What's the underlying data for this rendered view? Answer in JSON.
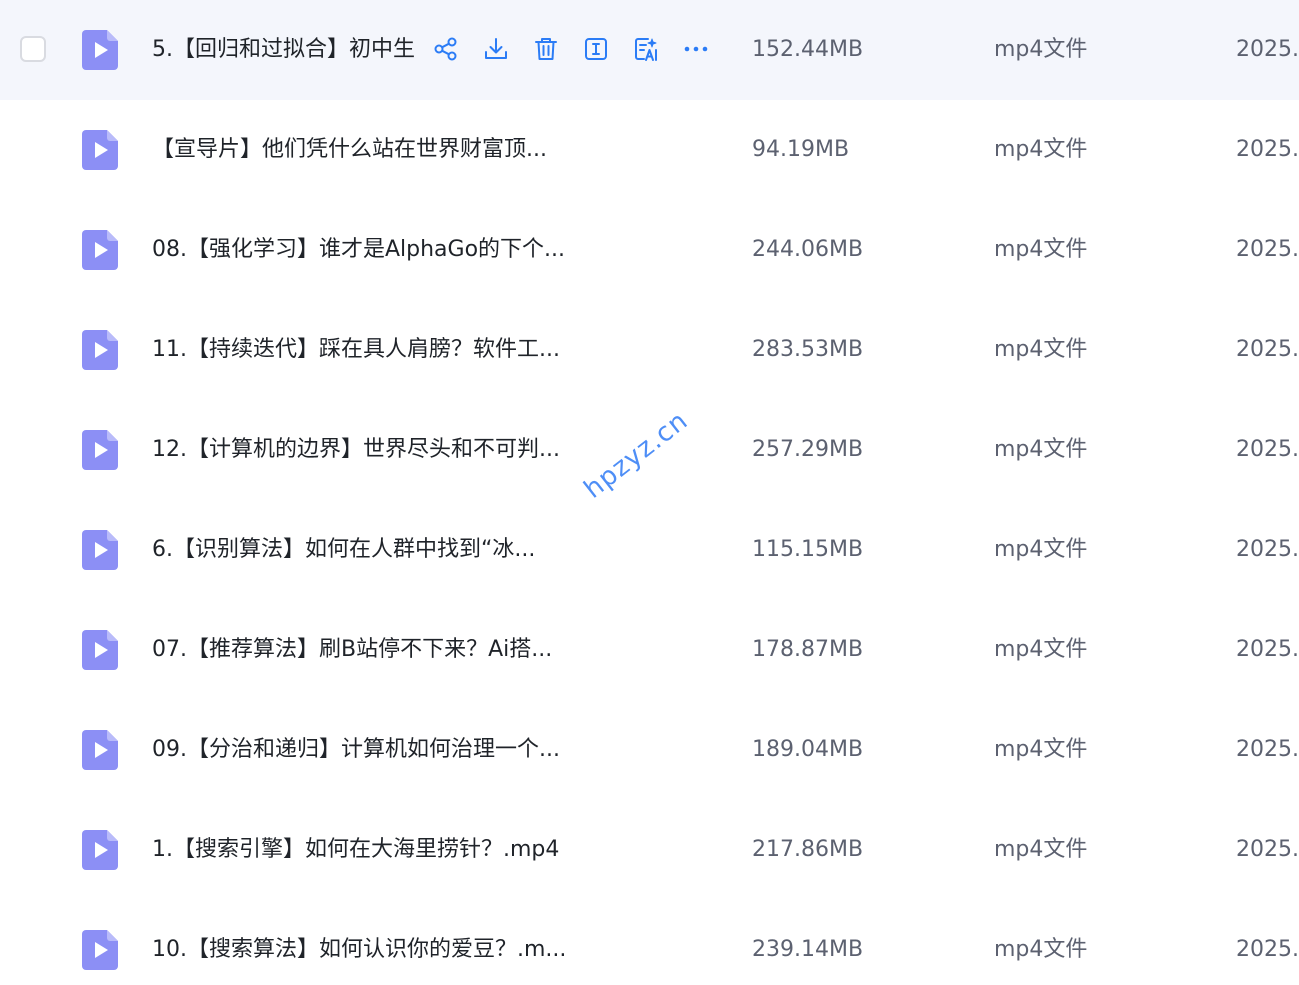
{
  "colors": {
    "accent": "#2b7cf6",
    "row_hover": "#f4f6fc",
    "video_icon": "#8c8ff5",
    "text_primary": "#1f2329",
    "text_secondary": "#5c6170",
    "watermark": "#3b82f6"
  },
  "watermark": "hpzyz.cn",
  "files": [
    {
      "name": "5.【回归和过拟合】初中生",
      "size": "152.44MB",
      "type": "mp4文件",
      "date": "2025.",
      "icon": "video-file-icon"
    },
    {
      "name": "【宣导片】他们凭什么站在世界财富顶...",
      "size": "94.19MB",
      "type": "mp4文件",
      "date": "2025.",
      "icon": "video-file-icon"
    },
    {
      "name": "08.【强化学习】谁才是AlphaGo的下个...",
      "size": "244.06MB",
      "type": "mp4文件",
      "date": "2025.",
      "icon": "video-file-icon"
    },
    {
      "name": "11.【持续迭代】踩在具人肩膀？软件工...",
      "size": "283.53MB",
      "type": "mp4文件",
      "date": "2025.",
      "icon": "video-file-icon"
    },
    {
      "name": "12.【计算机的边界】世界尽头和不可判...",
      "size": "257.29MB",
      "type": "mp4文件",
      "date": "2025.",
      "icon": "video-file-icon"
    },
    {
      "name": "6.【识别算法】如何在人群中找到“冰...",
      "size": "115.15MB",
      "type": "mp4文件",
      "date": "2025.",
      "icon": "video-file-icon"
    },
    {
      "name": "07.【推荐算法】刷B站停不下来？Ai搭...",
      "size": "178.87MB",
      "type": "mp4文件",
      "date": "2025.",
      "icon": "video-file-icon"
    },
    {
      "name": "09.【分治和递归】计算机如何治理一个...",
      "size": "189.04MB",
      "type": "mp4文件",
      "date": "2025.",
      "icon": "video-file-icon"
    },
    {
      "name": "1.【搜索引擎】如何在大海里捞针？.mp4",
      "size": "217.86MB",
      "type": "mp4文件",
      "date": "2025.",
      "icon": "video-file-icon"
    },
    {
      "name": "10.【搜索算法】如何认识你的爱豆？.m...",
      "size": "239.14MB",
      "type": "mp4文件",
      "date": "2025.",
      "icon": "video-file-icon"
    }
  ],
  "row_actions": [
    {
      "name": "share-icon"
    },
    {
      "name": "download-icon"
    },
    {
      "name": "delete-icon"
    },
    {
      "name": "rename-icon"
    },
    {
      "name": "ai-summary-icon"
    },
    {
      "name": "more-icon"
    }
  ]
}
